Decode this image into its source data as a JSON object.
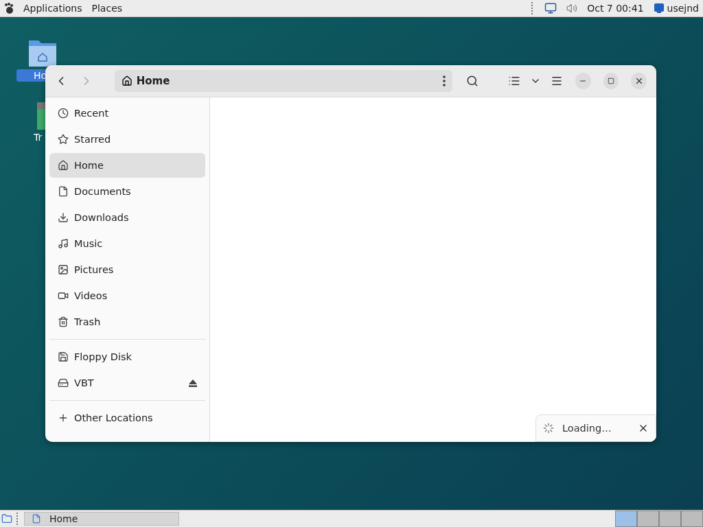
{
  "top_panel": {
    "menus": [
      {
        "label": "Applications"
      },
      {
        "label": "Places"
      }
    ],
    "clock": "Oct 7  00:41",
    "user": "usejnd"
  },
  "desktop_icons": [
    {
      "label": "Ho",
      "kind": "home",
      "selected": true
    },
    {
      "label": "Tr",
      "kind": "trash",
      "selected": false
    }
  ],
  "window": {
    "path": "Home",
    "sidebar": {
      "places": [
        {
          "label": "Recent",
          "selected": false
        },
        {
          "label": "Starred",
          "selected": false
        },
        {
          "label": "Home",
          "selected": true
        },
        {
          "label": "Documents",
          "selected": false
        },
        {
          "label": "Downloads",
          "selected": false
        },
        {
          "label": "Music",
          "selected": false
        },
        {
          "label": "Pictures",
          "selected": false
        },
        {
          "label": "Videos",
          "selected": false
        },
        {
          "label": "Trash",
          "selected": false
        }
      ],
      "devices": [
        {
          "label": "Floppy Disk",
          "selected": false,
          "eject": false
        },
        {
          "label": "VBT",
          "selected": false,
          "eject": true
        }
      ],
      "other": {
        "label": "Other Locations"
      }
    },
    "toast": {
      "text": "Loading…"
    }
  },
  "taskbar": {
    "tasks": [
      {
        "label": "Home",
        "selected": false
      }
    ],
    "workspaces": [
      {
        "selected": true
      },
      {
        "selected": false
      },
      {
        "selected": false
      },
      {
        "selected": false
      }
    ]
  }
}
